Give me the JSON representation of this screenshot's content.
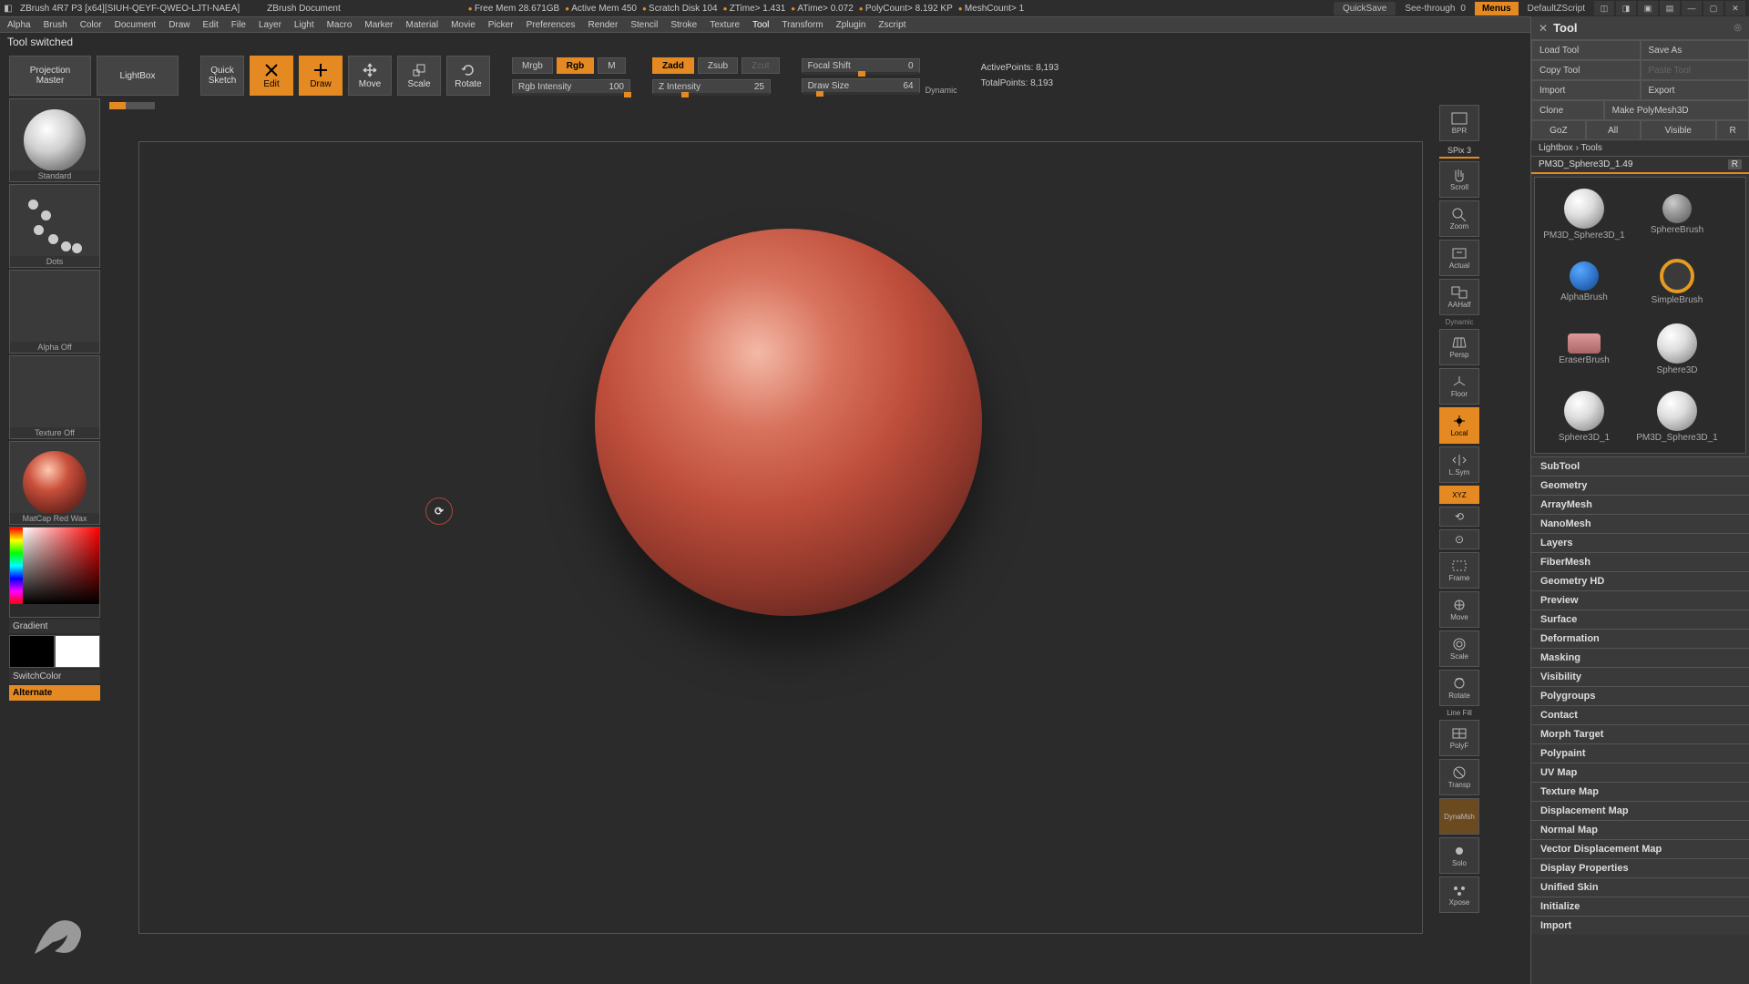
{
  "title": {
    "app": "ZBrush 4R7 P3 [x64][SIUH-QEYF-QWEO-LJTI-NAEA]",
    "doc": "ZBrush Document",
    "stats": [
      "Free Mem 28.671GB",
      "Active Mem 450",
      "Scratch Disk 104",
      "ZTime> 1.431",
      "ATime> 0.072",
      "PolyCount> 8.192 KP",
      "MeshCount> 1"
    ],
    "quicksave": "QuickSave",
    "seethrough": "See-through",
    "seethrough_val": "0",
    "menus": "Menus",
    "script": "DefaultZScript"
  },
  "menu": [
    "Alpha",
    "Brush",
    "Color",
    "Document",
    "Draw",
    "Edit",
    "File",
    "Layer",
    "Light",
    "Macro",
    "Marker",
    "Material",
    "Movie",
    "Picker",
    "Preferences",
    "Render",
    "Stencil",
    "Stroke",
    "Texture",
    "Tool",
    "Transform",
    "Zplugin",
    "Zscript"
  ],
  "status": "Tool switched",
  "shelf": {
    "projection": "Projection\nMaster",
    "lightbox": "LightBox",
    "quick_sketch": "Quick\nSketch",
    "modes": [
      "Edit",
      "Draw",
      "Move",
      "Scale",
      "Rotate"
    ],
    "mrgb": "Mrgb",
    "rgb": "Rgb",
    "m": "M",
    "rgb_int": "Rgb Intensity",
    "rgb_int_val": "100",
    "zadd": "Zadd",
    "zsub": "Zsub",
    "zcut": "Zcut",
    "z_int": "Z Intensity",
    "z_int_val": "25",
    "focal": "Focal Shift",
    "focal_val": "0",
    "draw": "Draw Size",
    "draw_val": "64",
    "dynamic": "Dynamic",
    "active_pts": "ActivePoints:",
    "active_val": "8,193",
    "total_pts": "TotalPoints:",
    "total_val": "8,193"
  },
  "left": {
    "brush": "Standard",
    "stroke": "Dots",
    "alpha": "Alpha Off",
    "texture": "Texture Off",
    "material": "MatCap Red Wax",
    "gradient": "Gradient",
    "switchcolor": "SwitchColor",
    "alternate": "Alternate"
  },
  "toolstrip": [
    "BPR",
    "Scroll",
    "Zoom",
    "Actual",
    "AAHalf",
    "Persp",
    "Floor",
    "Local",
    "L.Sym",
    "XYZ",
    "Frame",
    "Move",
    "Scale",
    "Rotate",
    "Line Fill",
    "PolyF",
    "Transp",
    "DynaMsh",
    "Solo",
    "Xpose"
  ],
  "toolstrip_spix": "SPix 3",
  "toolstrip_dyn": "Dynamic",
  "tool": {
    "title": "Tool",
    "load": "Load Tool",
    "save": "Save As",
    "copy": "Copy Tool",
    "paste": "Paste Tool",
    "import": "Import",
    "export": "Export",
    "clone": "Clone",
    "makepoly": "Make PolyMesh3D",
    "goz": "GoZ",
    "all": "All",
    "visible": "Visible",
    "r": "R",
    "lightbox": "Lightbox › Tools",
    "mesh_name": "PM3D_Sphere3D_1.49",
    "mesh_r": "R",
    "items": [
      {
        "name": "PM3D_Sphere3D_1",
        "kind": "ball-white"
      },
      {
        "name": "SphereBrush",
        "kind": "ball-brush"
      },
      {
        "name": "AlphaBrush",
        "kind": "ball-alpha"
      },
      {
        "name": "SimpleBrush",
        "kind": "ball-ring"
      },
      {
        "name": "EraserBrush",
        "kind": "ball-eraser"
      },
      {
        "name": "Sphere3D",
        "kind": "ball-white"
      },
      {
        "name": "Sphere3D_1",
        "kind": "ball-white"
      },
      {
        "name": "PM3D_Sphere3D_1",
        "kind": "ball-white"
      }
    ],
    "accordion": [
      "SubTool",
      "Geometry",
      "ArrayMesh",
      "NanoMesh",
      "Layers",
      "FiberMesh",
      "Geometry HD",
      "Preview",
      "Surface",
      "Deformation",
      "Masking",
      "Visibility",
      "Polygroups",
      "Contact",
      "Morph Target",
      "Polypaint",
      "UV Map",
      "Texture Map",
      "Displacement Map",
      "Normal Map",
      "Vector Displacement Map",
      "Display Properties",
      "Unified Skin",
      "Initialize",
      "Import"
    ]
  }
}
